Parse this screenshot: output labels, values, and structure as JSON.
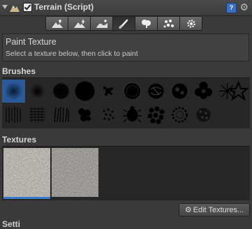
{
  "component": {
    "title": "Terrain (Script)",
    "enabled": true,
    "icons": [
      "foldout-arrow",
      "terrain-icon",
      "help-icon",
      "gear-icon"
    ]
  },
  "toolbar": {
    "tools": [
      {
        "name": "raise-lower-terrain-icon",
        "active": false
      },
      {
        "name": "paint-height-icon",
        "active": false
      },
      {
        "name": "smooth-height-icon",
        "active": false
      },
      {
        "name": "paint-texture-icon",
        "active": true
      },
      {
        "name": "place-trees-icon",
        "active": false
      },
      {
        "name": "paint-details-icon",
        "active": false
      },
      {
        "name": "terrain-settings-icon",
        "active": false
      }
    ]
  },
  "info": {
    "title": "Paint Texture",
    "description": "Select a texture below, then click to paint"
  },
  "brushes": {
    "label": "Brushes",
    "selected_index": 0,
    "count": 20
  },
  "textures": {
    "label": "Textures",
    "selected_index": 0,
    "count": 2
  },
  "edit_textures_button": {
    "label": "Edit Textures...",
    "icon": "gear-icon"
  },
  "next_section": {
    "label": "Setti"
  }
}
